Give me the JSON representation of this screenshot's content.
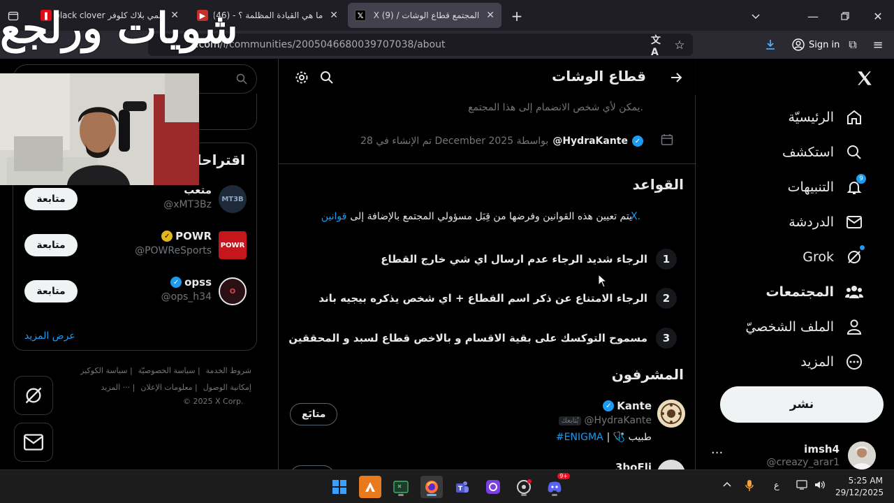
{
  "browser": {
    "tabs": [
      {
        "title": "أنمي بلاك كلوفر black clover -",
        "favicon_color": "#e50914"
      },
      {
        "title": "ما هي القيادة المظلمة ؟ - (46)",
        "favicon_color": "#c4302b"
      },
      {
        "title": "المجتمع قطاع الوشات / X (9)",
        "favicon_color": "#000000"
      }
    ],
    "url_host": "x.com",
    "url_path": "/i/communities/2005046680039707038/about",
    "signin_label": "Sign in"
  },
  "overlay": {
    "title": "شويات ورلجع"
  },
  "nav": {
    "items": [
      {
        "label": "الرئيسيّة",
        "icon": "home-icon"
      },
      {
        "label": "استكشف",
        "icon": "search-icon"
      },
      {
        "label": "التنبيهات",
        "icon": "bell-icon",
        "badge": "9"
      },
      {
        "label": "الدردشة",
        "icon": "envelope-icon"
      },
      {
        "label": "Grok",
        "icon": "grok-icon"
      },
      {
        "label": "المجتمعات",
        "icon": "communities-icon"
      },
      {
        "label": "الملف الشخصيّ",
        "icon": "person-icon"
      },
      {
        "label": "المزيد",
        "icon": "more-circle-icon"
      }
    ],
    "post_label": "نشر",
    "profile": {
      "name": "imsh4",
      "handle": "@creazy_arar1"
    }
  },
  "main": {
    "title": "قطاع الوشات",
    "join_text": ".يمكن لأي شخص الانضمام إلى هذا المجتمع",
    "creator_handle": "@HydraKante",
    "created_text": "بواسطة December 2025 تم الإنشاء في 28",
    "rules_title": "القواعد",
    "rules_intro": "يتم تعيين هذه القوانين وفرضها من قِبَل مسؤولي المجتمع بالإضافة إلى",
    "rules_intro_link": "قوانين",
    "rules_intro_x": "X.",
    "rules": [
      {
        "num": "1",
        "text": "الرجاء شديد الرجاء عدم ارسال اي شي خارج القطاع"
      },
      {
        "num": "2",
        "text": "الرجاء الامتناع عن ذكر اسم القطاع + اي شخص يذكره بيجيه باند"
      },
      {
        "num": "3",
        "text": "مسموح التوكسك على بقية الاقسام و بالاخص قطاع لسبد و المحققين"
      }
    ],
    "mods_title": "المشرفون",
    "moderator": {
      "name": "Kante",
      "handle": "@HydraKante",
      "follows_you": "يُتابعك",
      "bio_text": "طبيب 🩺 |",
      "bio_tag": "#ENIGMA",
      "follow_label": "متابَع"
    },
    "next_name": "3boEli"
  },
  "sidebar": {
    "who_title": "اقتراحات",
    "accounts": [
      {
        "name": "متعب",
        "handle": "@xMT3Bz",
        "avatar_text": "MT3B",
        "avatar_color": "#1e2a3a",
        "verified": false,
        "follow": "متابعة"
      },
      {
        "name": "POWR",
        "handle": "@POWReSports",
        "avatar_text": "POWR",
        "avatar_color": "#c4161c",
        "verified": true,
        "verified_color": "#e2b719",
        "follow": "متابعة"
      },
      {
        "name": "opss",
        "handle": "@ops_h34",
        "avatar_text": "O",
        "avatar_color": "#2a0f14",
        "verified": true,
        "verified_color": "#1d9bf0",
        "follow": "متابعة"
      }
    ],
    "show_more": "عرض المزيد",
    "footer_line1": [
      "شروط الخدمة",
      "سياسة الخصوصيّة",
      "سياسة الكوكيز"
    ],
    "footer_line2": [
      "إمكانية الوصول",
      "معلومات الإعلان",
      "··· المزيد"
    ],
    "copyright": "© 2025 X Corp."
  },
  "taskbar": {
    "lang": "ع",
    "time": "5:25 AM",
    "date": "29/12/2025",
    "discord_badge": "9+"
  }
}
